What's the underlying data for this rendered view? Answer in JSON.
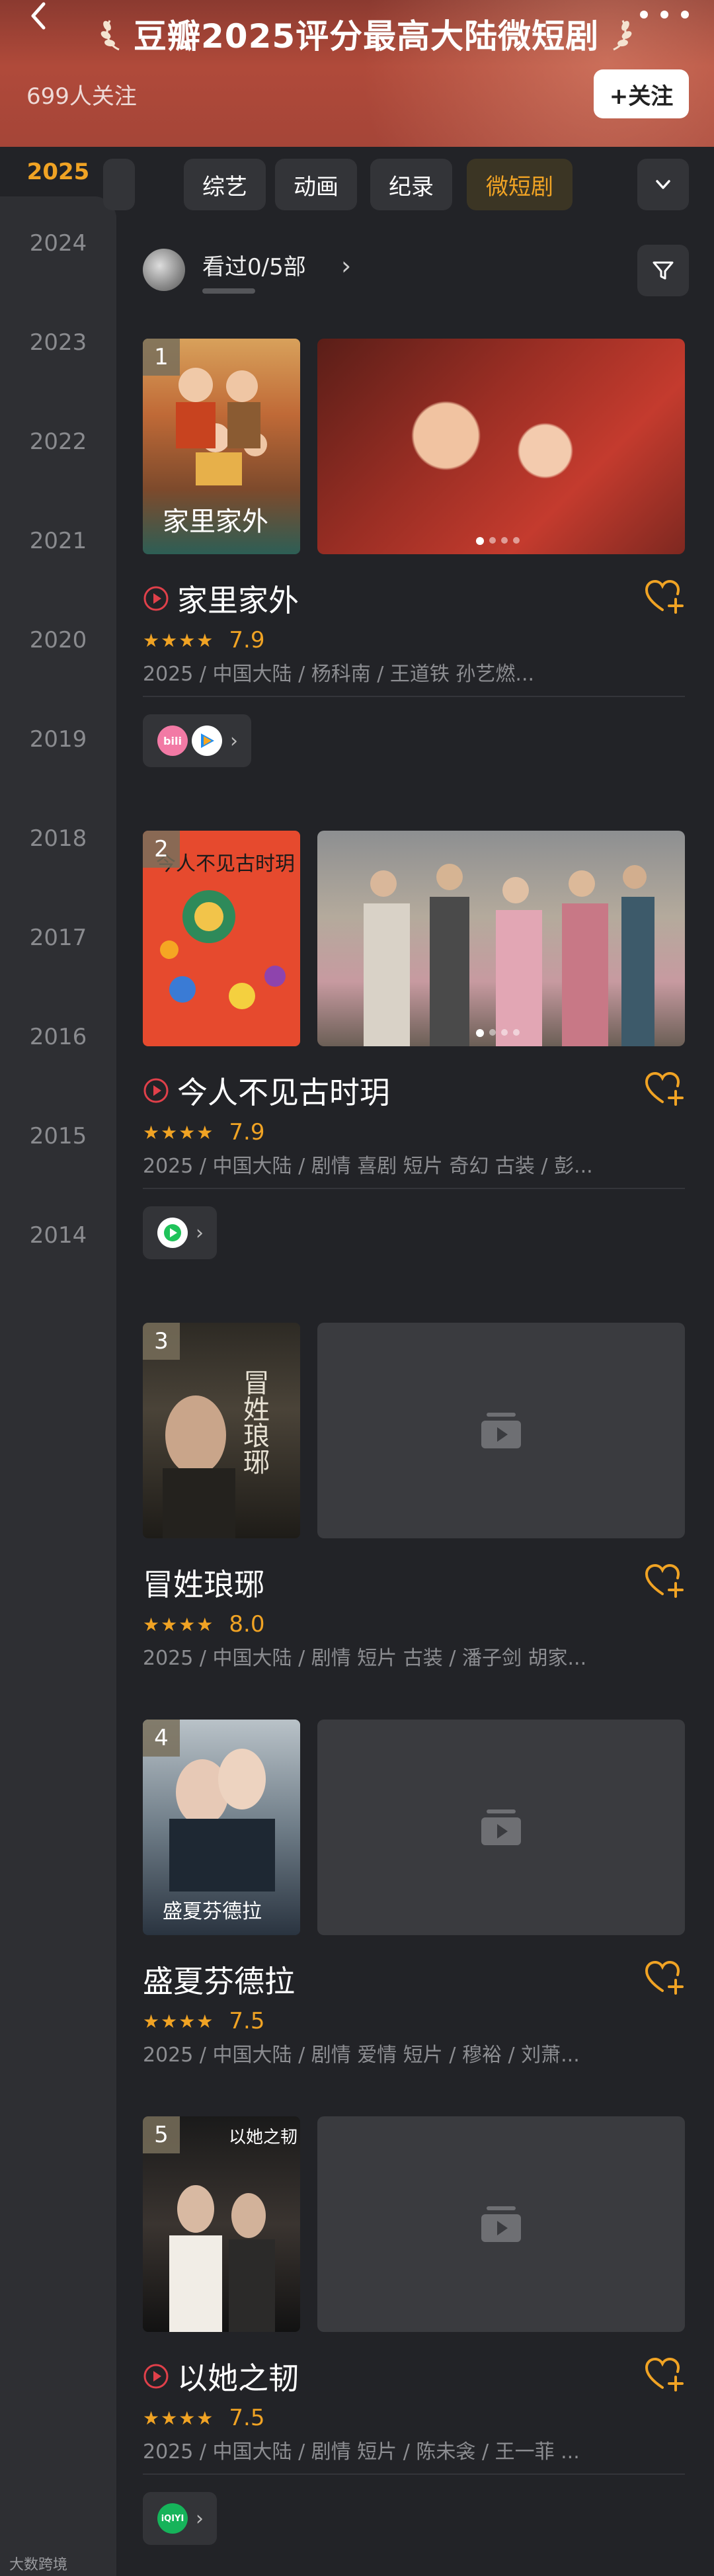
{
  "header": {
    "title": "豆瓣2025评分最高大陆微短剧",
    "follower_count": "699人关注",
    "follow_label": "+关注"
  },
  "sidebar": {
    "years": [
      "2025",
      "2024",
      "2023",
      "2022",
      "2021",
      "2020",
      "2019",
      "2018",
      "2017",
      "2016",
      "2015",
      "2014"
    ],
    "active": "2025"
  },
  "tabs": {
    "partial": "",
    "items": [
      "综艺",
      "动画",
      "纪录",
      "微短剧"
    ],
    "active": "微短剧"
  },
  "watched": {
    "text": "看过0/5部",
    "progress": 0
  },
  "items": [
    {
      "rank": "1",
      "title": "家里家外",
      "stars": "★★★★",
      "score": "7.9",
      "meta": "2025 / 中国大陆 / 杨科南 / 王道铁 孙艺燃...",
      "has_play": true,
      "poster_text": "家里家外",
      "platforms": [
        "bilibili",
        "tencent-video"
      ]
    },
    {
      "rank": "2",
      "title": "今人不见古时玥",
      "stars": "★★★★",
      "score": "7.9",
      "meta": "2025 / 中国大陆 / 剧情 喜剧 短片 奇幻 古装 / 彭...",
      "has_play": true,
      "poster_text": "今人不见古时玥",
      "platforms": [
        "iqiyi"
      ]
    },
    {
      "rank": "3",
      "title": "冒姓琅琊",
      "stars": "★★★★",
      "score": "8.0",
      "meta": "2025 / 中国大陆 / 剧情 短片 古装 / 潘子剑 胡家...",
      "has_play": false,
      "poster_text": "冒姓琅琊",
      "platforms": []
    },
    {
      "rank": "4",
      "title": "盛夏芬德拉",
      "stars": "★★★★",
      "score": "7.5",
      "meta": "2025 / 中国大陆 / 剧情 爱情 短片 / 穆裕 / 刘萧...",
      "has_play": false,
      "poster_text": "盛夏芬德拉",
      "platforms": []
    },
    {
      "rank": "5",
      "title": "以她之韧",
      "stars": "★★★★",
      "score": "7.5",
      "meta": "2025 / 中国大陆 / 剧情 短片 / 陈未衾 / 王一菲 ...",
      "has_play": true,
      "poster_text": "以她之韧",
      "platforms": [
        "iqiyi-green"
      ]
    }
  ],
  "footer": {
    "watermark": "大数跨境"
  },
  "colors": {
    "accent": "#f0a324",
    "background": "#222327",
    "sidebar": "#2e2f33",
    "play_icon": "#e0404a"
  }
}
